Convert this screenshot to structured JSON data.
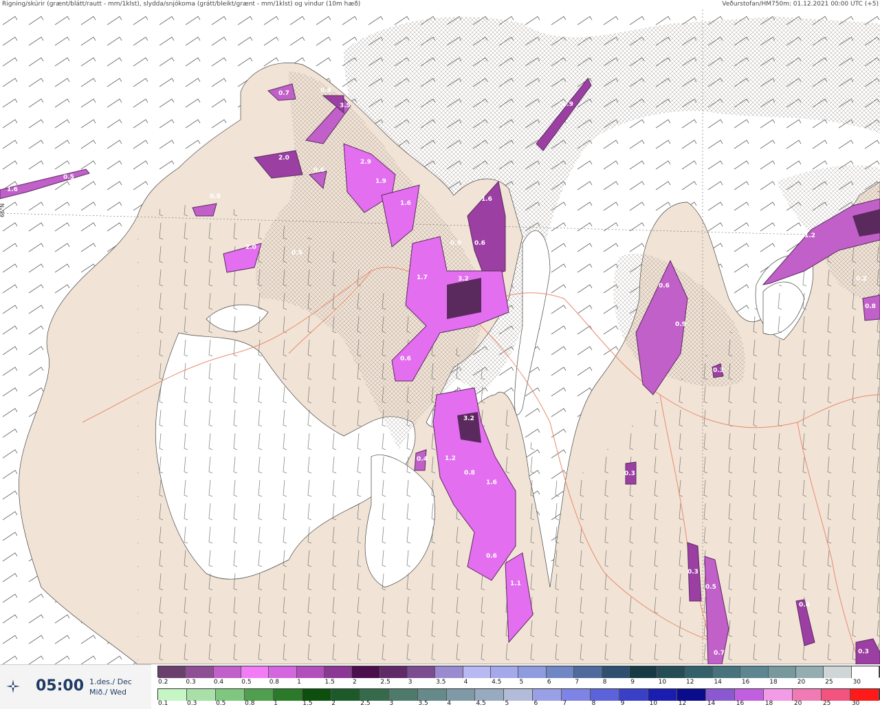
{
  "header": {
    "title_left": "Rigning/skúrir (grænt/blátt/rautt - mm/1klst), slydda/snjókoma (grátt/bleikt/grænt - mm/1klst) og vindur (10m hæð)",
    "title_right": "Veðurstofan/HM750m: 01.12.2021 00:00 UTC (+5)"
  },
  "map": {
    "lat_label": "66°N",
    "precip_labels": [
      "1.6",
      "0.5",
      "0.7",
      "0.4",
      "3.5",
      "2.0",
      "0.6",
      "2.9",
      "1.9",
      "1.6",
      "0.8",
      "2.0",
      "0.5",
      "1.9",
      "1.6",
      "0.9",
      "0.6",
      "1.7",
      "3.2",
      "0.6",
      "3.2",
      "1.2",
      "0.8",
      "1.6",
      "0.6",
      "1.1",
      "0.6",
      "0.9",
      "0.3",
      "1.2",
      "0.2",
      "0.8",
      "0.3",
      "0.3",
      "0.5",
      "0.4",
      "0.7",
      "0.3",
      "0.4"
    ],
    "colors": {
      "land": "#f1e4d6",
      "sea": "#ffffff",
      "road": "#e8896b",
      "wind_barb": "#555555",
      "precip_dark": "#5a2a5e",
      "precip_mid": "#9b3fa3",
      "precip_light": "#e36ef0"
    }
  },
  "footer": {
    "time": "05:00",
    "date_line1": "1.des./ Dec",
    "date_line2": "Mið./ Wed",
    "wind_icon": "wind-compass-icon",
    "snow_scale": {
      "labels": [
        "0.2",
        "0.3",
        "0.4",
        "0.5",
        "0.8",
        "1",
        "1.5",
        "2",
        "2.5",
        "3",
        "3.5",
        "4",
        "4.5",
        "5",
        "6",
        "7",
        "8",
        "9",
        "10",
        "12",
        "14",
        "16",
        "18",
        "20",
        "25",
        "30"
      ],
      "colors": [
        "#6b3f6d",
        "#8e4f94",
        "#c060c8",
        "#f27cf5",
        "#d466e0",
        "#b24fbd",
        "#8a3893",
        "#4a0f4c",
        "#5f2a66",
        "#7b4c90",
        "#9a8ad0",
        "#b8b8f2",
        "#a3a9eb",
        "#8e9bdf",
        "#6f87c4",
        "#4f6a9b",
        "#2f4f6f",
        "#173a45",
        "#244d55",
        "#34606a",
        "#48727c",
        "#5e8690",
        "#77999e",
        "#93adb1",
        "#cfd6d8",
        "#ffffff"
      ]
    },
    "rain_scale": {
      "labels": [
        "0.1",
        "0.3",
        "0.5",
        "0.8",
        "1",
        "1.5",
        "2",
        "2.5",
        "3",
        "3.5",
        "4",
        "4.5",
        "5",
        "6",
        "7",
        "8",
        "9",
        "10",
        "12",
        "14",
        "16",
        "18",
        "20",
        "25",
        "30"
      ],
      "colors": [
        "#c6f5c6",
        "#a8e0a8",
        "#7fc77f",
        "#4f9f4f",
        "#2a7a2a",
        "#0d4f0d",
        "#1d5a2a",
        "#356a4a",
        "#4d7a6a",
        "#668a8a",
        "#7f9aa6",
        "#98aac0",
        "#b2bcd8",
        "#9aa0e6",
        "#7d84e6",
        "#5c62d9",
        "#3a3fc8",
        "#1a1db0",
        "#0a0c8c",
        "#8a58d0",
        "#c060e0",
        "#f29ce8",
        "#f27ab4",
        "#f2547f",
        "#ff1a1a"
      ]
    }
  }
}
